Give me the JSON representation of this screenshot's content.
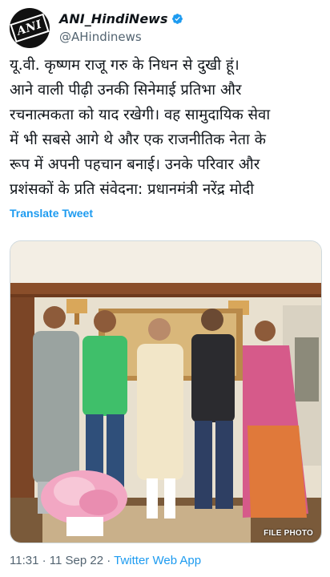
{
  "account": {
    "display_name": "ANI_HindiNews",
    "handle": "@AHindinews",
    "avatar_text": "ANI",
    "verified_icon": "verified-badge-icon",
    "verified_color": "#1d9bf0"
  },
  "tweet": {
    "lines": [
      "यू.वी. कृष्णम राजू गरु के निधन से दुखी हूं।",
      "आने वाली पीढ़ी उनकी सिनेमाई प्रतिभा और",
      "रचनात्मकता को याद रखेगी। वह सामुदायिक सेवा",
      "में भी सबसे आगे थे और एक राजनीतिक नेता के",
      "रूप में अपनी पहचान बनाई। उनके परिवार और",
      "प्रशंसकों के प्रति संवेदना: प्रधानमंत्री नरेंद्र मोदी"
    ],
    "translate_label": "Translate Tweet"
  },
  "media": {
    "watermark": "FILE PHOTO"
  },
  "meta": {
    "time": "11:31",
    "separator": " · ",
    "date": "11 Sep 22",
    "app": "Twitter Web App"
  },
  "colors": {
    "link": "#1d9bf0",
    "secondary_text": "#536471",
    "border": "#cfd9de"
  }
}
